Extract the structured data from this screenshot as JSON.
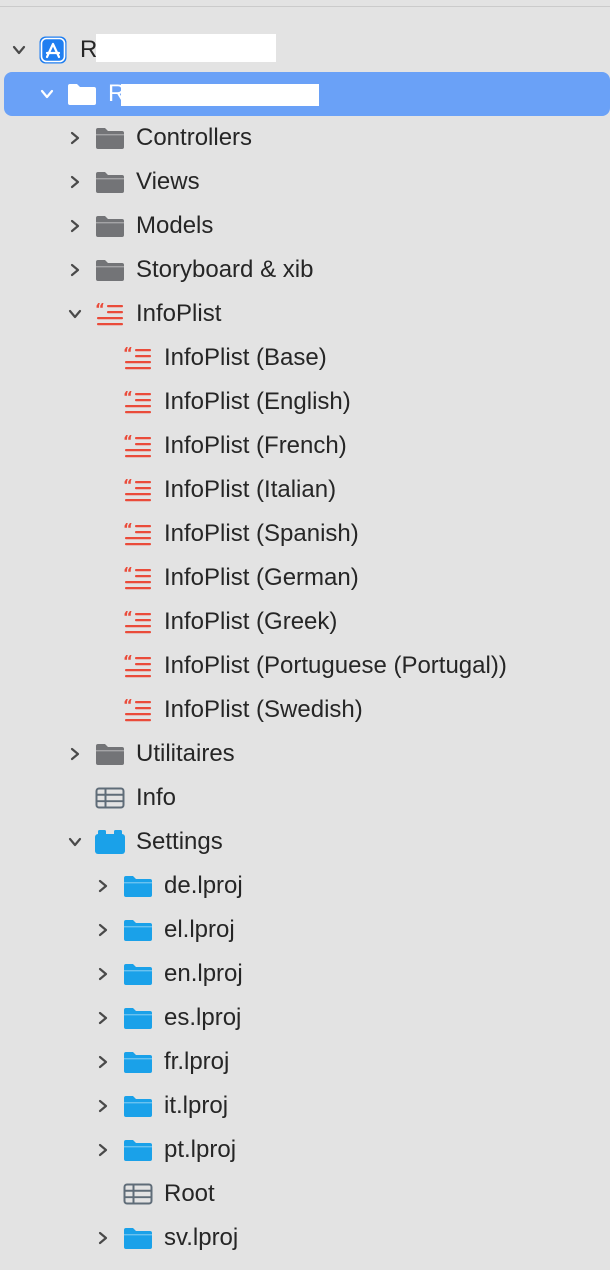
{
  "colors": {
    "background": "#e3e3e3",
    "selection": "#6aa1f7",
    "folder_gray": "#737477",
    "folder_blue": "#1aa1e9",
    "strings_red": "#ea4b3a",
    "app_blue": "#1f7ef0",
    "chevron": "#4a4a4a"
  },
  "navigator": {
    "rows": [
      {
        "label": "R",
        "icon": "app-store-icon",
        "disclosure": "expanded",
        "level": 0,
        "redacted": true
      },
      {
        "label": "R",
        "icon": "folder-icon",
        "disclosure": "expanded",
        "level": 1,
        "redacted": true,
        "selected": true
      },
      {
        "label": "Controllers",
        "icon": "folder-icon",
        "disclosure": "collapsed",
        "level": 2
      },
      {
        "label": "Views",
        "icon": "folder-icon",
        "disclosure": "collapsed",
        "level": 2
      },
      {
        "label": "Models",
        "icon": "folder-icon",
        "disclosure": "collapsed",
        "level": 2
      },
      {
        "label": "Storyboard & xib",
        "icon": "folder-icon",
        "disclosure": "collapsed",
        "level": 2
      },
      {
        "label": "InfoPlist",
        "icon": "strings-file-icon",
        "disclosure": "expanded",
        "level": 2
      },
      {
        "label": "InfoPlist (Base)",
        "icon": "strings-file-icon",
        "disclosure": "none",
        "level": 3
      },
      {
        "label": "InfoPlist (English)",
        "icon": "strings-file-icon",
        "disclosure": "none",
        "level": 3
      },
      {
        "label": "InfoPlist (French)",
        "icon": "strings-file-icon",
        "disclosure": "none",
        "level": 3
      },
      {
        "label": "InfoPlist (Italian)",
        "icon": "strings-file-icon",
        "disclosure": "none",
        "level": 3
      },
      {
        "label": "InfoPlist (Spanish)",
        "icon": "strings-file-icon",
        "disclosure": "none",
        "level": 3
      },
      {
        "label": "InfoPlist (German)",
        "icon": "strings-file-icon",
        "disclosure": "none",
        "level": 3
      },
      {
        "label": "InfoPlist (Greek)",
        "icon": "strings-file-icon",
        "disclosure": "none",
        "level": 3
      },
      {
        "label": "InfoPlist (Portuguese (Portugal))",
        "icon": "strings-file-icon",
        "disclosure": "none",
        "level": 3
      },
      {
        "label": "InfoPlist (Swedish)",
        "icon": "strings-file-icon",
        "disclosure": "none",
        "level": 3
      },
      {
        "label": "Utilitaires",
        "icon": "folder-icon",
        "disclosure": "collapsed",
        "level": 2
      },
      {
        "label": "Info",
        "icon": "plist-table-icon",
        "disclosure": "none",
        "level": 2
      },
      {
        "label": "Settings",
        "icon": "settings-bundle-icon",
        "disclosure": "expanded",
        "level": 2
      },
      {
        "label": "de.lproj",
        "icon": "blue-folder-icon",
        "disclosure": "collapsed",
        "level": 3
      },
      {
        "label": "el.lproj",
        "icon": "blue-folder-icon",
        "disclosure": "collapsed",
        "level": 3
      },
      {
        "label": "en.lproj",
        "icon": "blue-folder-icon",
        "disclosure": "collapsed",
        "level": 3
      },
      {
        "label": "es.lproj",
        "icon": "blue-folder-icon",
        "disclosure": "collapsed",
        "level": 3
      },
      {
        "label": "fr.lproj",
        "icon": "blue-folder-icon",
        "disclosure": "collapsed",
        "level": 3
      },
      {
        "label": "it.lproj",
        "icon": "blue-folder-icon",
        "disclosure": "collapsed",
        "level": 3
      },
      {
        "label": "pt.lproj",
        "icon": "blue-folder-icon",
        "disclosure": "collapsed",
        "level": 3
      },
      {
        "label": "Root",
        "icon": "plist-table-icon",
        "disclosure": "none",
        "level": 3
      },
      {
        "label": "sv.lproj",
        "icon": "blue-folder-icon",
        "disclosure": "collapsed",
        "level": 3
      }
    ]
  }
}
